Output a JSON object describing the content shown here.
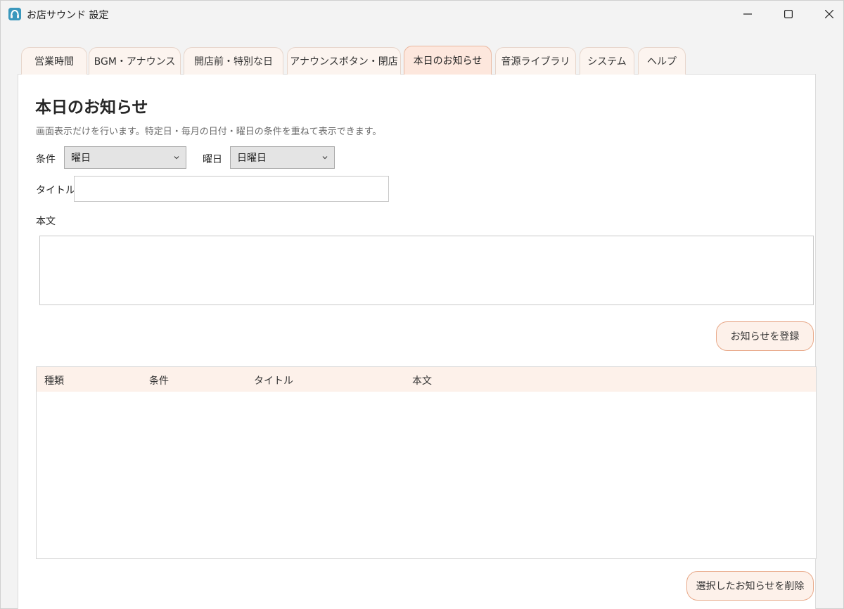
{
  "window": {
    "title": "お店サウンド 設定",
    "controls": {
      "minimize": "minimize-icon",
      "maximize": "maximize-icon",
      "close": "close-icon"
    }
  },
  "tabs": [
    {
      "label": "営業時間",
      "active": false
    },
    {
      "label": "BGM・アナウンス",
      "active": false
    },
    {
      "label": "開店前・特別な日",
      "active": false
    },
    {
      "label": "アナウンスボタン・閉店",
      "active": false
    },
    {
      "label": "本日のお知らせ",
      "active": true
    },
    {
      "label": "音源ライブラリ",
      "active": false
    },
    {
      "label": "システム",
      "active": false
    },
    {
      "label": "ヘルプ",
      "active": false
    }
  ],
  "page": {
    "heading": "本日のお知らせ",
    "description": "画面表示だけを行います。特定日・毎月の日付・曜日の条件を重ねて表示できます。"
  },
  "form": {
    "condition_label": "条件",
    "condition_value": "曜日",
    "weekday_label": "曜日",
    "weekday_value": "日曜日",
    "title_label": "タイトル",
    "title_value": "",
    "body_label": "本文",
    "body_value": "",
    "register_button": "お知らせを登録"
  },
  "table": {
    "columns": [
      "種類",
      "条件",
      "タイトル",
      "本文"
    ],
    "rows": []
  },
  "delete_button": "選択したお知らせを削除",
  "colors": {
    "accent_border": "#e8a888",
    "accent_fill": "#fdf1ea",
    "active_tab": "#fde7dd"
  }
}
